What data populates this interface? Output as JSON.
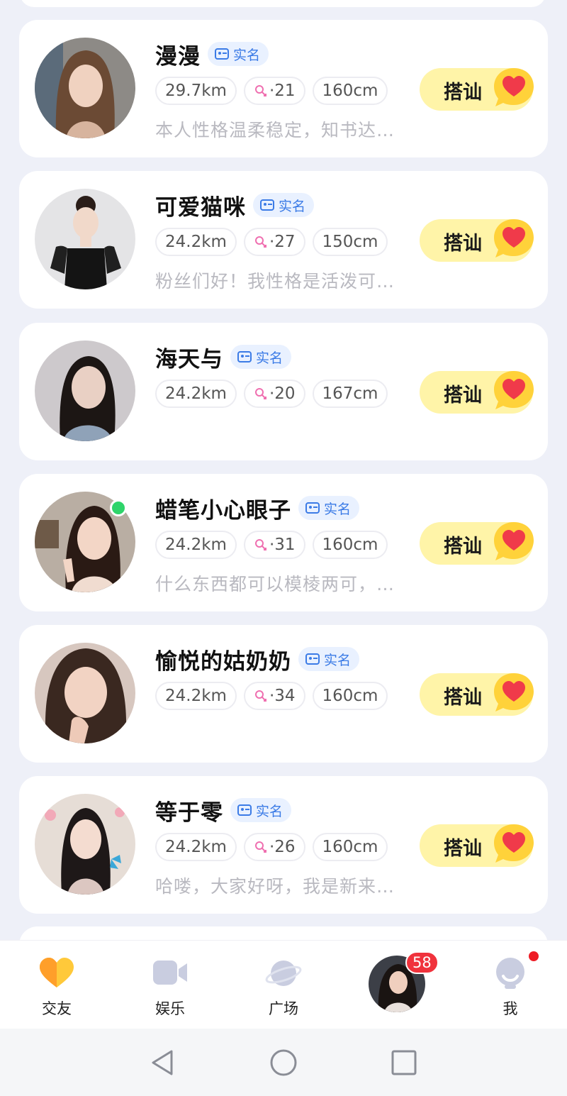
{
  "users": [
    {
      "name": "漫漫",
      "verified_label": "实名",
      "distance": "29.7km",
      "age": "·21",
      "height": "160cm",
      "bio": "本人性格温柔稳定，知书达…",
      "online": false
    },
    {
      "name": "可爱猫咪",
      "verified_label": "实名",
      "distance": "24.2km",
      "age": "·27",
      "height": "150cm",
      "bio": "粉丝们好！我性格是活泼可…",
      "online": false
    },
    {
      "name": "海天与",
      "verified_label": "实名",
      "distance": "24.2km",
      "age": "·20",
      "height": "167cm",
      "bio": "",
      "online": false
    },
    {
      "name": "蜡笔小心眼子",
      "verified_label": "实名",
      "distance": "24.2km",
      "age": "·31",
      "height": "160cm",
      "bio": "什么东西都可以模棱两可，…",
      "online": true
    },
    {
      "name": "愉悦的姑奶奶",
      "verified_label": "实名",
      "distance": "24.2km",
      "age": "·34",
      "height": "160cm",
      "bio": "",
      "online": false
    },
    {
      "name": "等于零",
      "verified_label": "实名",
      "distance": "24.2km",
      "age": "·26",
      "height": "160cm",
      "bio": "哈喽，大家好呀，我是新来…",
      "online": false
    }
  ],
  "chat_button_label": "搭讪",
  "tabbar": {
    "tabs": [
      {
        "label": "交友",
        "icon": "heart-icon"
      },
      {
        "label": "娱乐",
        "icon": "video-camera-icon"
      },
      {
        "label": "广场",
        "icon": "planet-icon"
      },
      {
        "label": "",
        "icon": "message-avatar",
        "badge": "58"
      },
      {
        "label": "我",
        "icon": "profile-icon"
      }
    ]
  },
  "colors": {
    "background": "#eef0f8",
    "chat_button": "#fff4a8",
    "verify_blue": "#3b7be6",
    "badge_red": "#f0323c",
    "online_green": "#2fd46a"
  }
}
